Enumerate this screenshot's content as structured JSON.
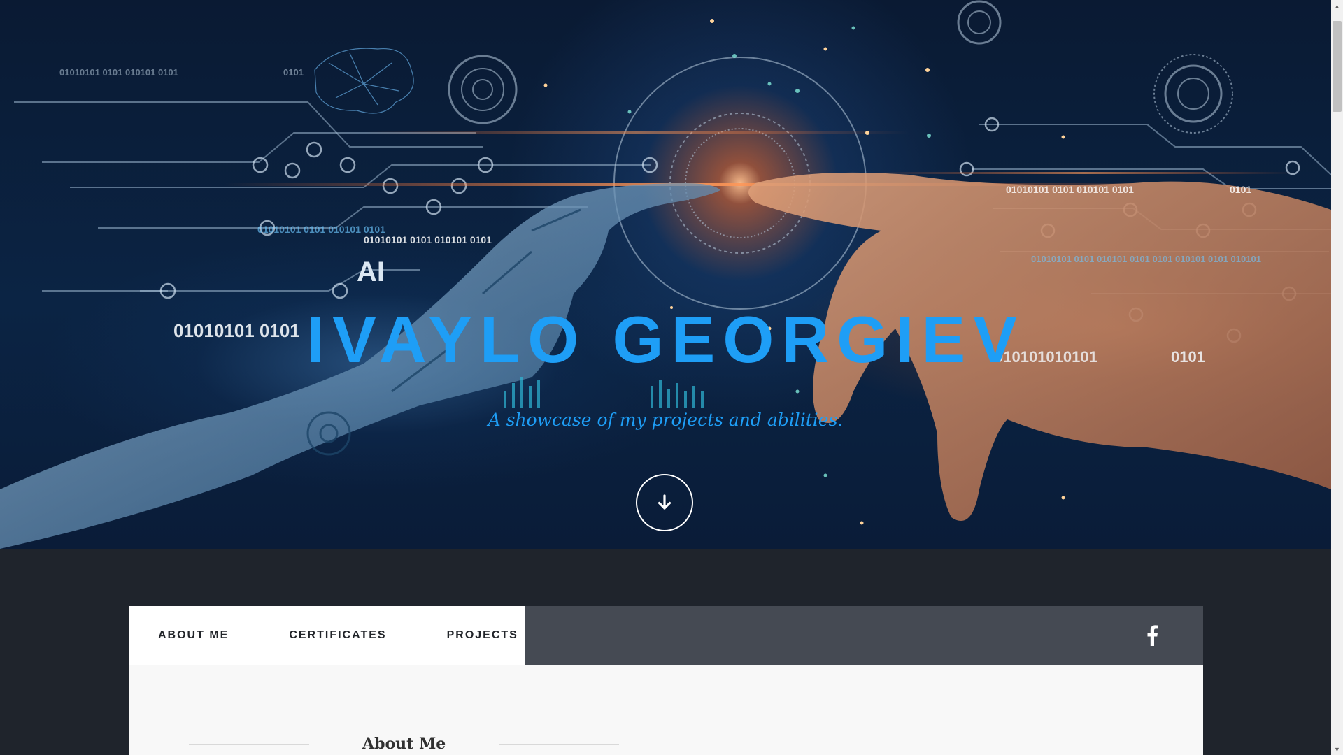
{
  "hero": {
    "title": "IVAYLO GEORGIEV",
    "subtitle": "A showcase of my projects and abilities.",
    "image_text": {
      "ai_label": "AI",
      "binary_a": "01010101 0101 010101 0101",
      "binary_b": "01010101 0101",
      "binary_c": "01010101 0101 010101 0101",
      "binary_d": "01010101 0101 010101 0101",
      "binary_e": "0101",
      "binary_f": "01010101 0101 010101  0101",
      "binary_g": "010101010101",
      "binary_h": "01010101 0101 010101 0101 0101 010101 0101 010101",
      "binary_i": "0101",
      "binary_j": "0101"
    },
    "scroll_icon": "arrow-down-icon"
  },
  "nav": {
    "items": [
      {
        "label": "ABOUT ME"
      },
      {
        "label": "CERTIFICATES"
      },
      {
        "label": "PROJECTS"
      }
    ],
    "social_icon": "facebook-icon"
  },
  "section": {
    "title": "About Me"
  },
  "colors": {
    "accent": "#1e9ef6",
    "navbar_bg": "#454a53",
    "page_bg": "#1f242c"
  }
}
